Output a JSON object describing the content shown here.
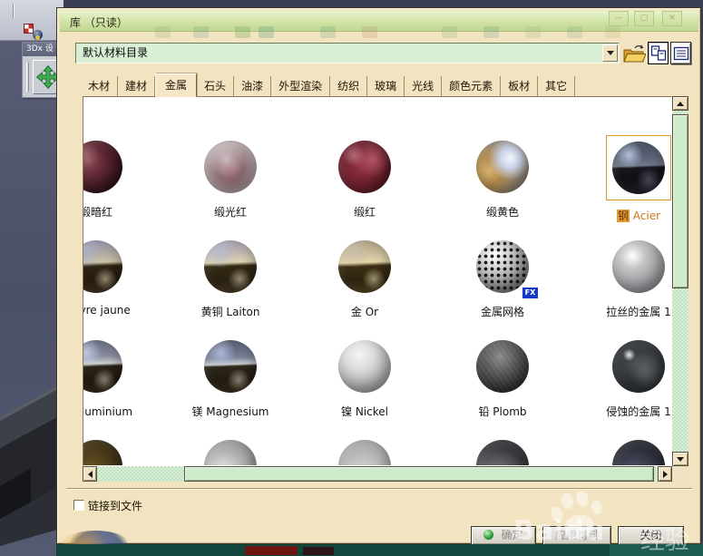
{
  "window": {
    "title": "库 （只读）",
    "buttons": [
      {
        "name": "minimize",
        "glyph": "—"
      },
      {
        "name": "maximize",
        "glyph": "▢"
      },
      {
        "name": "close",
        "glyph": "✕"
      }
    ]
  },
  "background_app": {
    "floating_toolbar_title": "3Dx 设"
  },
  "catalog_bar": {
    "value": "默认材料目录",
    "icons": [
      "dropdown-arrow",
      "open-folder",
      "large-icon-view",
      "details-view"
    ]
  },
  "tabs": {
    "active": "金属",
    "items": [
      "木材",
      "建材",
      "金属",
      "石头",
      "油漆",
      "外型渲染",
      "纺织",
      "玻璃",
      "光线",
      "颜色元素",
      "板材",
      "其它"
    ]
  },
  "materials": {
    "rows": [
      {
        "items": [
          {
            "label": "缎暗红"
          },
          {
            "label": "缎光红"
          },
          {
            "label": "缎红"
          },
          {
            "label": "缎黄色"
          },
          {
            "label_cn": "钢",
            "label_fr": "Acier",
            "selected": true
          }
        ]
      },
      {
        "items": [
          {
            "label": "Cuivre jaune"
          },
          {
            "label": "黄铜 Laiton"
          },
          {
            "label": "金 Or"
          },
          {
            "label": "金属网格",
            "badge": "FX"
          },
          {
            "label": "拉丝的金属 1"
          }
        ]
      },
      {
        "items": [
          {
            "label": "铝 Aluminium"
          },
          {
            "label": "镁 Magnesium"
          },
          {
            "label": "镍 Nickel"
          },
          {
            "label": "铅 Plomb"
          },
          {
            "label": "侵蚀的金属 1"
          }
        ]
      }
    ]
  },
  "footer": {
    "link_checkbox_label": "链接到文件",
    "checkbox_checked": false,
    "ok_label": "确定",
    "apply_label": "应用材料",
    "close_label": "关闭"
  },
  "watermark": {
    "brand": "Baidu",
    "suffix": "经验"
  },
  "colors": {
    "selection_orange": "#e09530",
    "dialog_beige": "#f2e3c1",
    "title_green": "#cfe2a2",
    "scroll_mint": "#cdeacb",
    "fx_badge_blue": "#1538c8"
  }
}
